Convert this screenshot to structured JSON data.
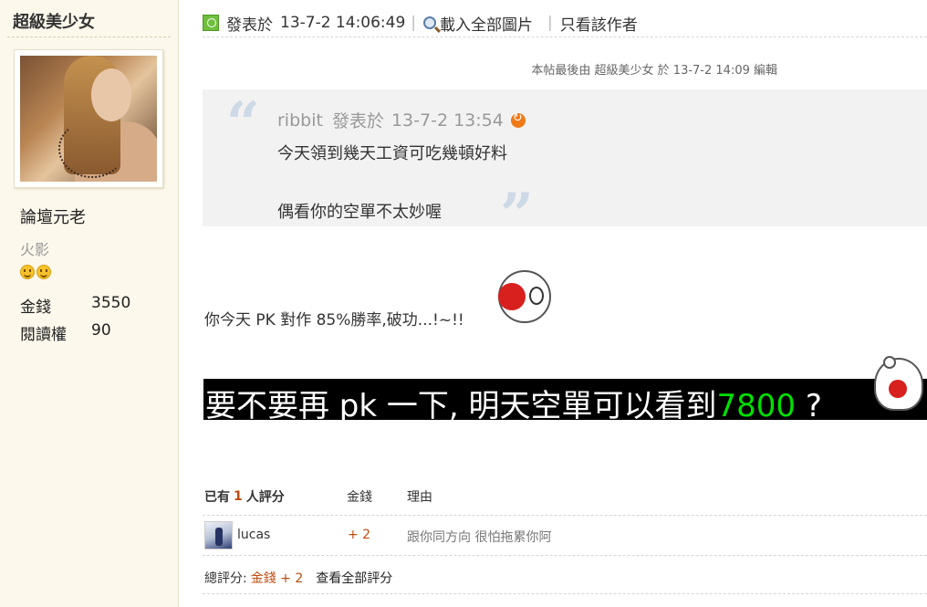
{
  "author": {
    "name": "超級美少女",
    "rank": "論壇元老",
    "rank_sub": "火影",
    "stats": [
      {
        "label": "金錢",
        "value": "3550"
      },
      {
        "label": "閱讀權",
        "value": "90"
      }
    ]
  },
  "post_header": {
    "posted_label": "發表於",
    "posted_time": "13-7-2 14:06:49",
    "load_images": "載入全部圖片",
    "author_only": "只看該作者"
  },
  "edit_note": "本帖最後由 超級美少女 於 13-7-2 14:09 編輯",
  "quote": {
    "open_mark": "“",
    "close_mark": "”",
    "author": "ribbit",
    "posted_label": "發表於",
    "time": "13-7-2 13:54",
    "line1": "今天領到幾天工資可吃幾頓好料",
    "line2": "偶看你的空單不太妙喔"
  },
  "body": {
    "line1": "你今天 PK 對作 85%勝率,破功...!~!!",
    "big_prefix": "要不要再 pk 一下, 明天空單可以看到",
    "big_highlight": "7800",
    "big_suffix": " ?"
  },
  "ratings": {
    "prefix": "已有",
    "count": "1",
    "suffix": "人評分",
    "col_money": "金錢",
    "col_reason": "理由",
    "rows": [
      {
        "user": "lucas",
        "money": "+ 2",
        "reason": "跟你同方向 很怕拖累你阿"
      }
    ],
    "total_label": "總評分:",
    "total_value": "金錢 + 2",
    "view_all": "查看全部評分"
  },
  "colors": {
    "sidebar_bg": "#FCF8EC",
    "quote_bg": "#F2F2F2",
    "highlight_green": "#00e000",
    "rating_accent": "#c04b10"
  }
}
